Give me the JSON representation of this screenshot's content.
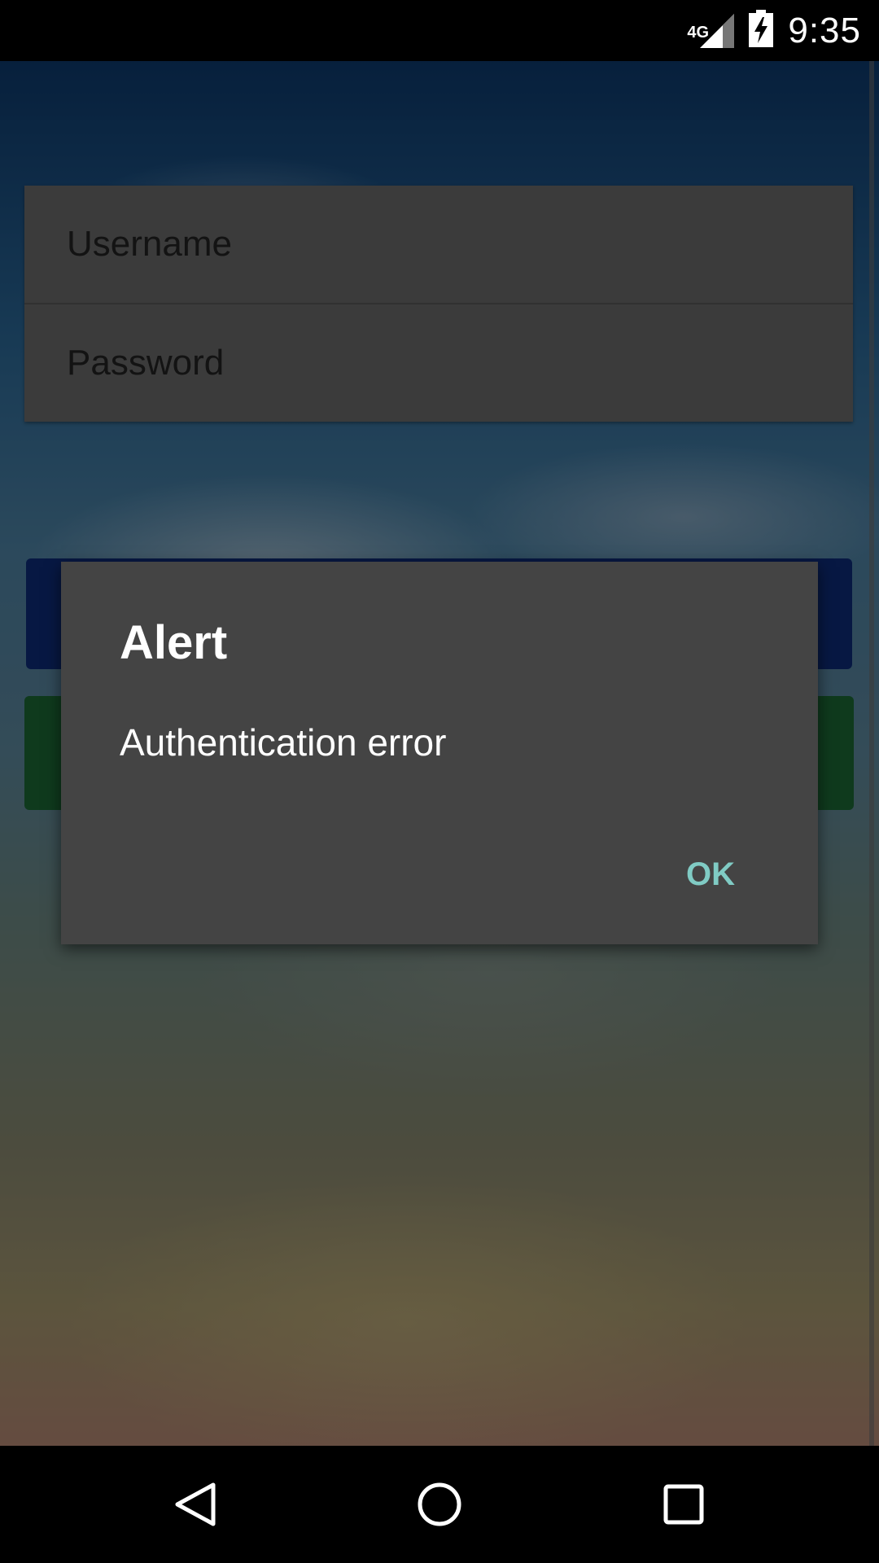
{
  "status_bar": {
    "network": "4G",
    "time": "9:35",
    "icons": [
      "signal-icon",
      "battery-charging-icon"
    ]
  },
  "login": {
    "username_placeholder": "Username",
    "password_placeholder": "Password"
  },
  "dialog": {
    "title": "Alert",
    "message": "Authentication error",
    "ok_label": "OK"
  },
  "nav_bar": {
    "icons": [
      "back-icon",
      "home-icon",
      "recents-icon"
    ]
  },
  "colors": {
    "accent": "#80cbc4",
    "dialog_bg": "#444444",
    "primary_button": "#0d2d7a",
    "secondary_button": "#1c6a36"
  }
}
